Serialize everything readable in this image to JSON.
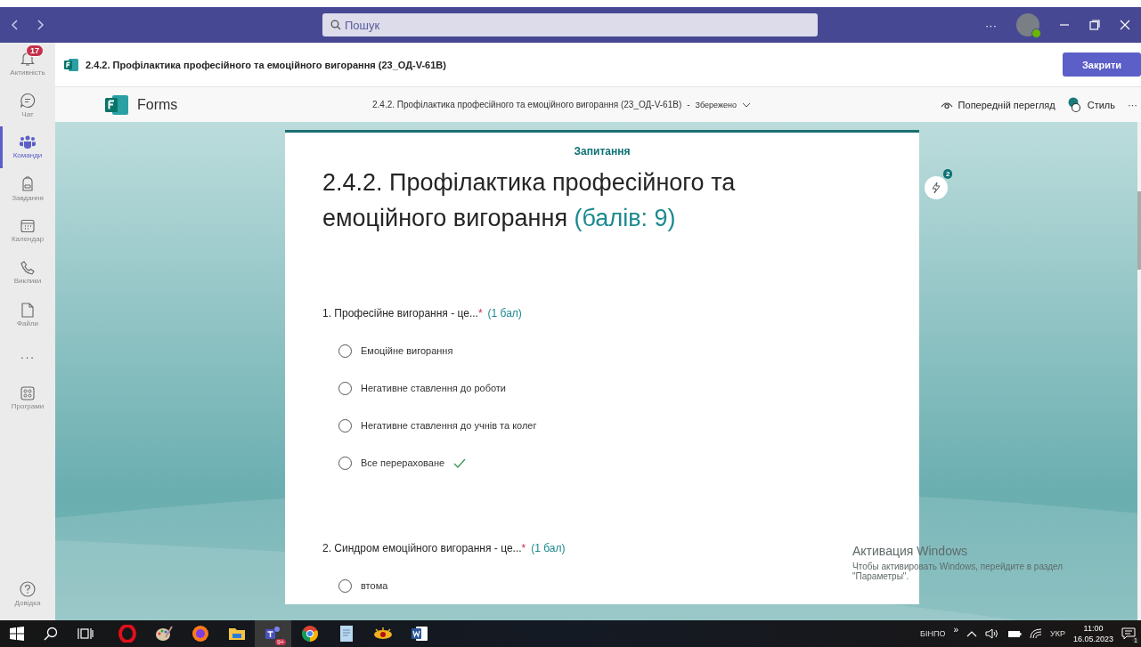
{
  "title_bar": {
    "search": {
      "placeholder": "Пошук"
    },
    "more": "···"
  },
  "sidebar": {
    "items": [
      {
        "kind": "activity",
        "label": "Активність",
        "badge": "17",
        "selected": false
      },
      {
        "kind": "chat",
        "label": "Чат",
        "selected": false
      },
      {
        "kind": "teams",
        "label": "Команди",
        "selected": true
      },
      {
        "kind": "assignments",
        "label": "Завдання",
        "selected": false
      },
      {
        "kind": "calendar",
        "label": "Календар",
        "selected": false
      },
      {
        "kind": "calls",
        "label": "Виклики",
        "selected": false
      },
      {
        "kind": "files",
        "label": "Файли",
        "selected": false
      },
      {
        "kind": "more",
        "label": "···",
        "selected": false
      },
      {
        "kind": "apps",
        "label": "Програми",
        "selected": false
      }
    ],
    "help": {
      "label": "Довідка"
    }
  },
  "tab_header": {
    "title": "2.4.2. Профілактика професійного та емоційного вигорання (23_ОД-V-61В)",
    "close_button": "Закрити"
  },
  "forms_bar": {
    "app_name": "Forms",
    "doc_title": "2.4.2. Профілактика професійного та емоційного вигорання (23_ОД-V-61В)",
    "separator": "-",
    "save_state": "Збережено",
    "preview": "Попередній перегляд",
    "style": "Стиль",
    "more": "···"
  },
  "form": {
    "tab": "Запитання",
    "title": "2.4.2. Профілактика професійного та емоційного вигорання",
    "points": "(балів: 9)",
    "questions": [
      {
        "number": "1.",
        "text": "Професійне вигорання - це...",
        "required_mark": "*",
        "points": "(1 бал)",
        "options": [
          {
            "label": "Емоційне вигорання",
            "selected": false,
            "correct": false
          },
          {
            "label": "Негативне ставлення до роботи",
            "selected": false,
            "correct": false
          },
          {
            "label": "Негативне ставлення до учнів та колег",
            "selected": false,
            "correct": false
          },
          {
            "label": "Все перераховане",
            "selected": false,
            "correct": true
          }
        ]
      },
      {
        "number": "2.",
        "text": "Синдром емоційного вигорання - це...",
        "required_mark": "*",
        "points": "(1 бал)",
        "options": [
          {
            "label": "втома",
            "selected": false,
            "correct": false
          }
        ]
      }
    ]
  },
  "ideas_button": {
    "badge": "2"
  },
  "activation_notice": {
    "title": "Активация Windows",
    "text": "Чтобы активировать Windows, перейдите в раздел \"Параметры\"."
  },
  "taskbar": {
    "apps": [
      {
        "kind": "opera"
      },
      {
        "kind": "paint"
      },
      {
        "kind": "firefox"
      },
      {
        "kind": "explorer"
      },
      {
        "kind": "teams",
        "badge": "9+",
        "selected": true
      },
      {
        "kind": "chrome"
      },
      {
        "kind": "notepad"
      },
      {
        "kind": "eye"
      },
      {
        "kind": "word"
      }
    ],
    "tray": {
      "user": "БІНПО",
      "expand": "»",
      "language": "УКР",
      "time": "11:00",
      "date": "16.05.2023",
      "notifications": "1"
    }
  }
}
